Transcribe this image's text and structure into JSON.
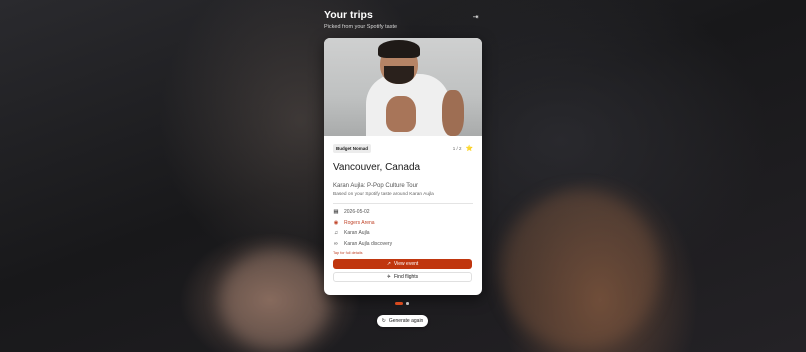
{
  "header": {
    "title": "Your trips",
    "subtitle": "Picked from your Spotify taste",
    "logout_icon": "logout-icon"
  },
  "card": {
    "badge": "Budget Nomad",
    "pager": "1 / 2",
    "share_icon": "share-icon",
    "city": "Vancouver, Canada",
    "event_name": "Karan Aujla: P-Pop Culture Tour",
    "based_on": "Based on your Spotify taste around Karan Aujla",
    "details": [
      {
        "icon": "calendar-icon",
        "text": "2026-05-02"
      },
      {
        "icon": "map-pin-icon",
        "text": "Rogers Arena"
      },
      {
        "icon": "music-note-icon",
        "text": "Karan Aujla"
      },
      {
        "icon": "link-icon",
        "text": "Karan Aujla discovery"
      }
    ],
    "tap_hint": "Tap for full details",
    "view_event_label": "View event",
    "find_flights_label": "Find flights"
  },
  "pagination": {
    "active_index": 1,
    "total": 2
  },
  "regenerate_label": "Generate again",
  "colors": {
    "accent": "#c0360e",
    "venue": "#c0452a"
  }
}
